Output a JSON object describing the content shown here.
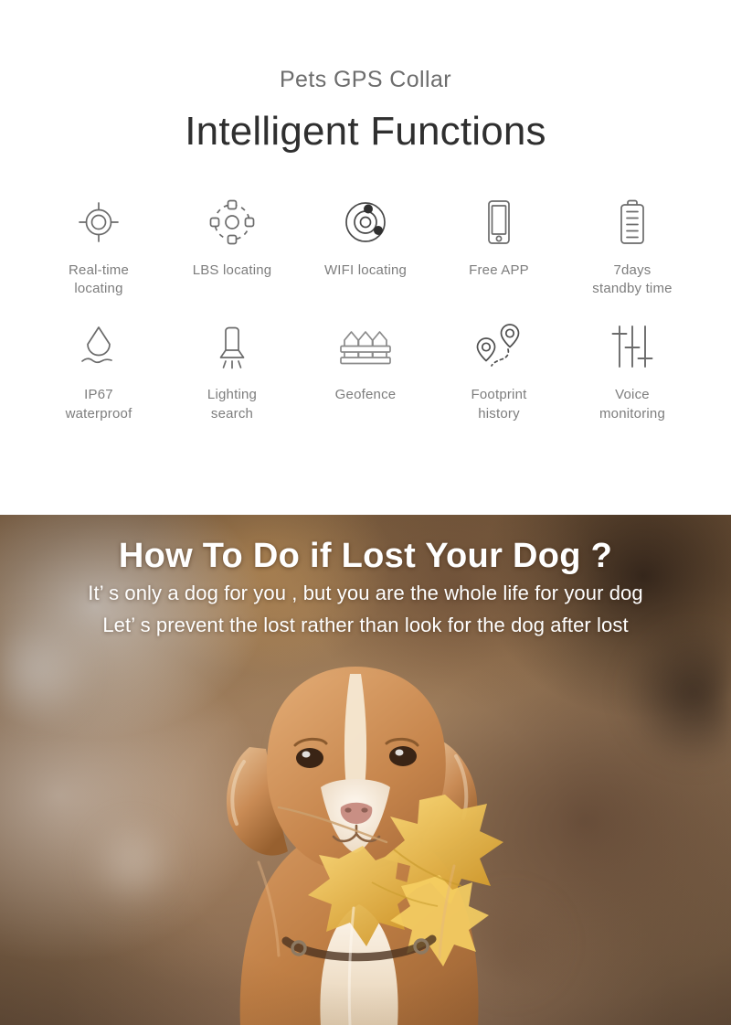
{
  "features_section": {
    "subtitle": "Pets GPS Collar",
    "title": "Intelligent Functions",
    "label_color": "#7d7d7d",
    "title_color": "#2f2f2f",
    "icon_stroke_color": "#6b6b6b",
    "rows": [
      [
        {
          "icon": "gps-target-icon",
          "label": "Real-time\nlocating"
        },
        {
          "icon": "lbs-network-icon",
          "label": "LBS locating"
        },
        {
          "icon": "wifi-orbit-icon",
          "label": "WIFI locating"
        },
        {
          "icon": "smartphone-icon",
          "label": "Free APP"
        },
        {
          "icon": "battery-icon",
          "label": "7days\nstandby time"
        }
      ],
      [
        {
          "icon": "water-drop-icon",
          "label": "IP67\nwaterproof"
        },
        {
          "icon": "flashlight-icon",
          "label": "Lighting\nsearch"
        },
        {
          "icon": "fence-icon",
          "label": "Geofence"
        },
        {
          "icon": "map-pins-path-icon",
          "label": "Footprint\nhistory"
        },
        {
          "icon": "sliders-icon",
          "label": "Voice\nmonitoring"
        }
      ]
    ]
  },
  "banner": {
    "title": "How To Do if Lost Your Dog ?",
    "line1": "It’ s only a dog for you , but you are the whole life for your dog",
    "line2": "Let’ s prevent the lost rather than look for the dog after lost",
    "text_color": "#ffffff",
    "photo_description": "Nova Scotia Duck Tolling Retriever holding yellow maple leaves on a blurred autumn forest path"
  }
}
